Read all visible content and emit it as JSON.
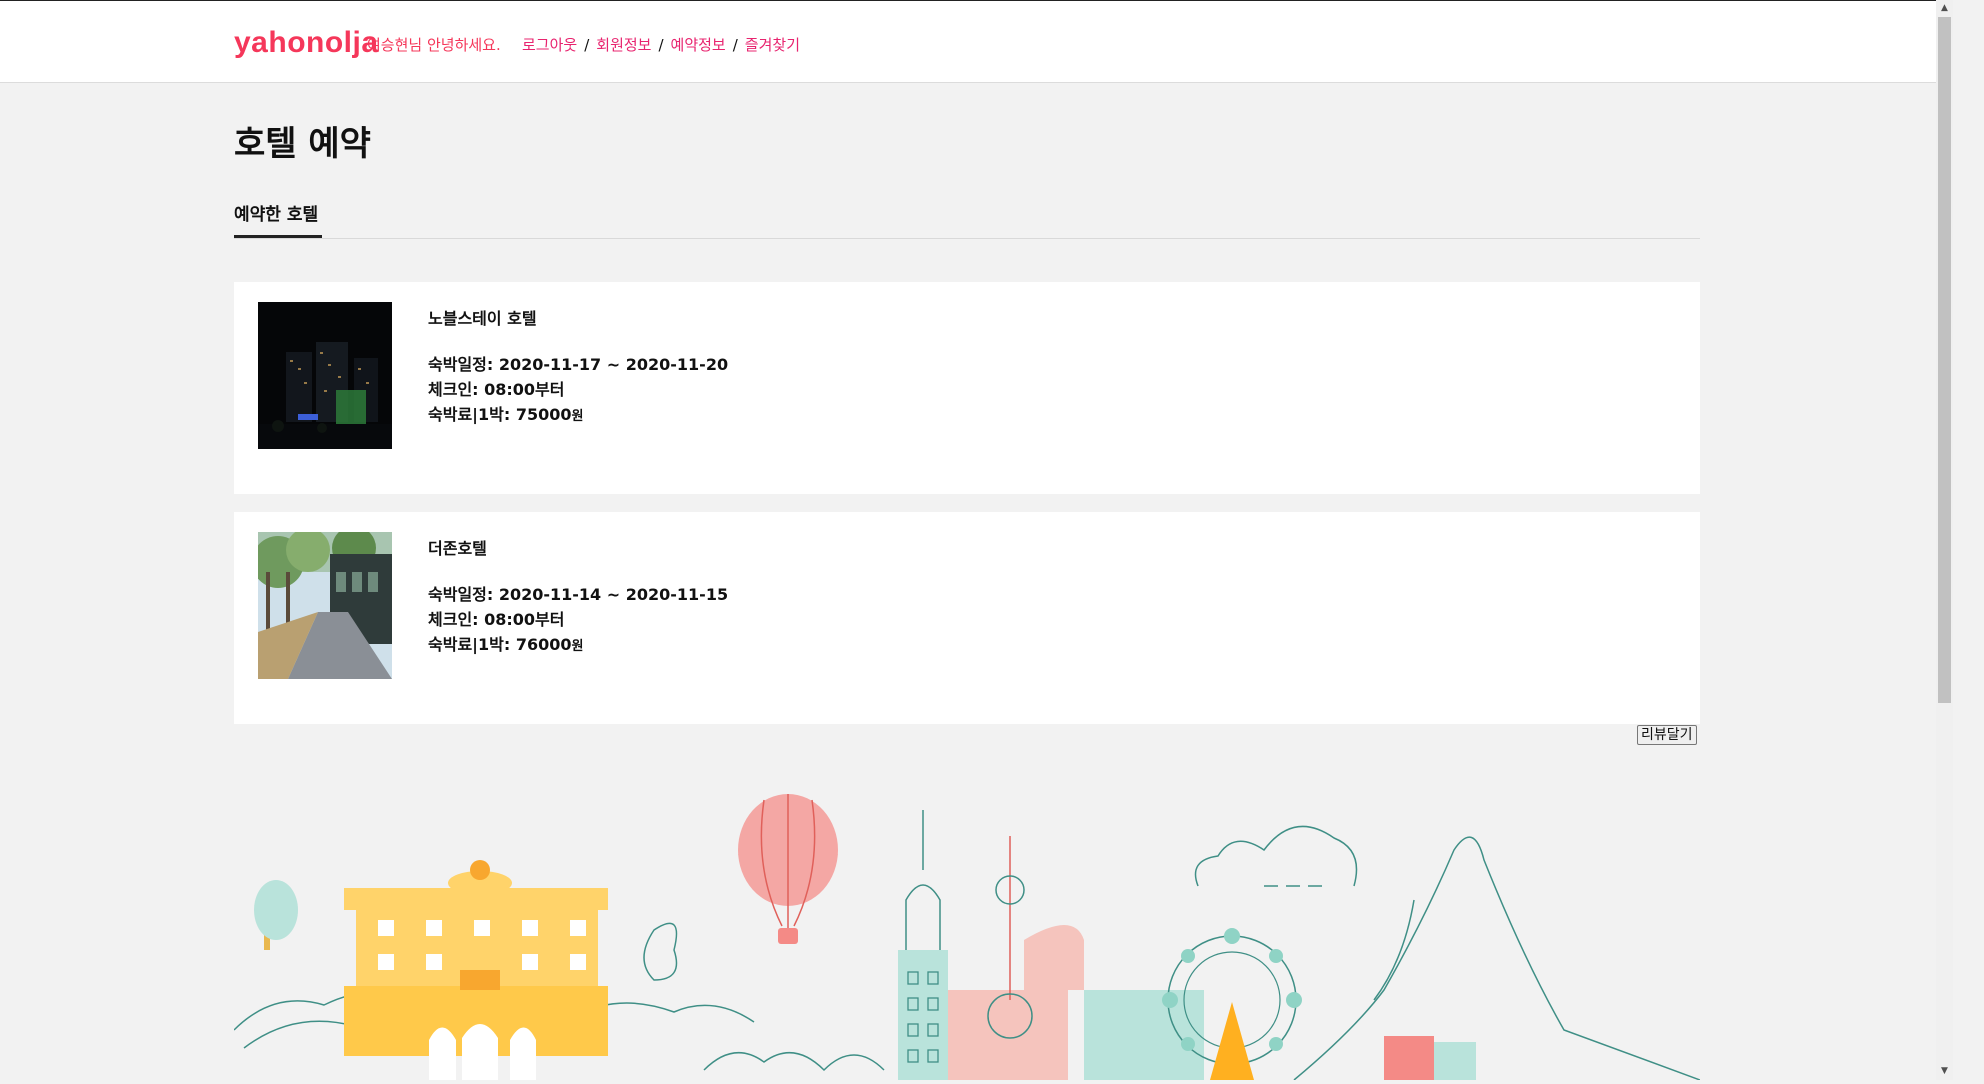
{
  "header": {
    "logo": "yahonolja",
    "greeting": "여승현님 안녕하세요.",
    "nav": {
      "logout": "로그아웃",
      "member_info": "회원정보",
      "reservation_info": "예약정보",
      "favorites": "즐겨찾기",
      "separator": "/"
    }
  },
  "page": {
    "title": "호텔 예약",
    "tab": "예약한 호텔"
  },
  "reservations": [
    {
      "name": "노블스테이 호텔",
      "stay": "숙박일정: 2020-11-17 ~ 2020-11-20",
      "checkin": "체크인: 08:00부터",
      "price_label": "숙박료|1박: 75000",
      "currency": "원"
    },
    {
      "name": "더존호텔",
      "stay": "숙박일정: 2020-11-14 ~ 2020-11-15",
      "checkin": "체크인: 08:00부터",
      "price_label": "숙박료|1박: 76000",
      "currency": "원"
    }
  ],
  "review_button": "리뷰달기",
  "icons": [
    "hotel-night-photo",
    "hotel-street-photo",
    "city-skyline-illustration",
    "scroll-up-icon",
    "scroll-down-icon"
  ],
  "colors": {
    "brand": "#f5375a",
    "nav": "#e8246f",
    "background": "#f2f2f2",
    "card": "#ffffff"
  }
}
